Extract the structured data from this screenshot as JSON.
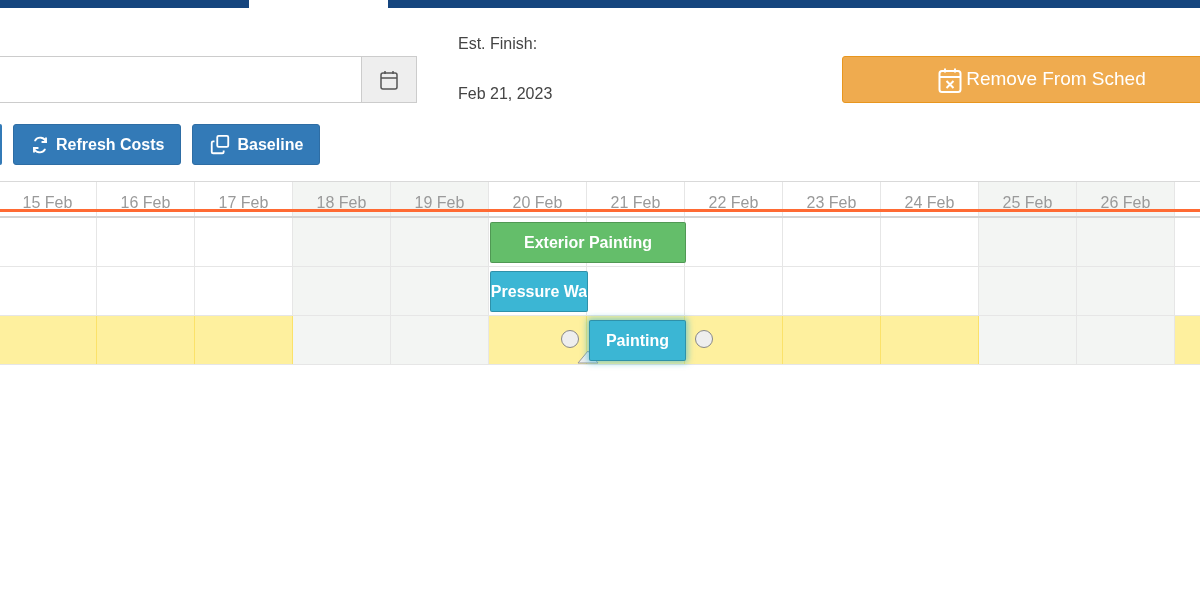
{
  "est_finish": {
    "label": "Est. Finish:",
    "value": "Feb 21, 2023"
  },
  "remove_button": {
    "label": "Remove From Sched"
  },
  "toolbar": [
    {
      "label": "Refresh Costs"
    },
    {
      "label": "Baseline"
    }
  ],
  "gantt": {
    "columns": [
      {
        "label": "15 Feb",
        "weekend": false
      },
      {
        "label": "16 Feb",
        "weekend": false
      },
      {
        "label": "17 Feb",
        "weekend": false
      },
      {
        "label": "18 Feb",
        "weekend": true
      },
      {
        "label": "19 Feb",
        "weekend": true
      },
      {
        "label": "20 Feb",
        "weekend": false
      },
      {
        "label": "21 Feb",
        "weekend": false
      },
      {
        "label": "22 Feb",
        "weekend": false
      },
      {
        "label": "23 Feb",
        "weekend": false
      },
      {
        "label": "24 Feb",
        "weekend": false
      },
      {
        "label": "25 Feb",
        "weekend": true
      },
      {
        "label": "26 Feb",
        "weekend": true
      }
    ],
    "rows": [
      {
        "highlighted": false,
        "task": {
          "label": "Exterior Painting",
          "color": "#64be6a",
          "selected": false
        }
      },
      {
        "highlighted": false,
        "task": {
          "label": "Pressure Wa",
          "color": "#3bb6d4",
          "selected": false
        }
      },
      {
        "highlighted": true,
        "task": {
          "label": "Painting",
          "color": "#3bb6d4",
          "selected": true
        }
      }
    ]
  }
}
